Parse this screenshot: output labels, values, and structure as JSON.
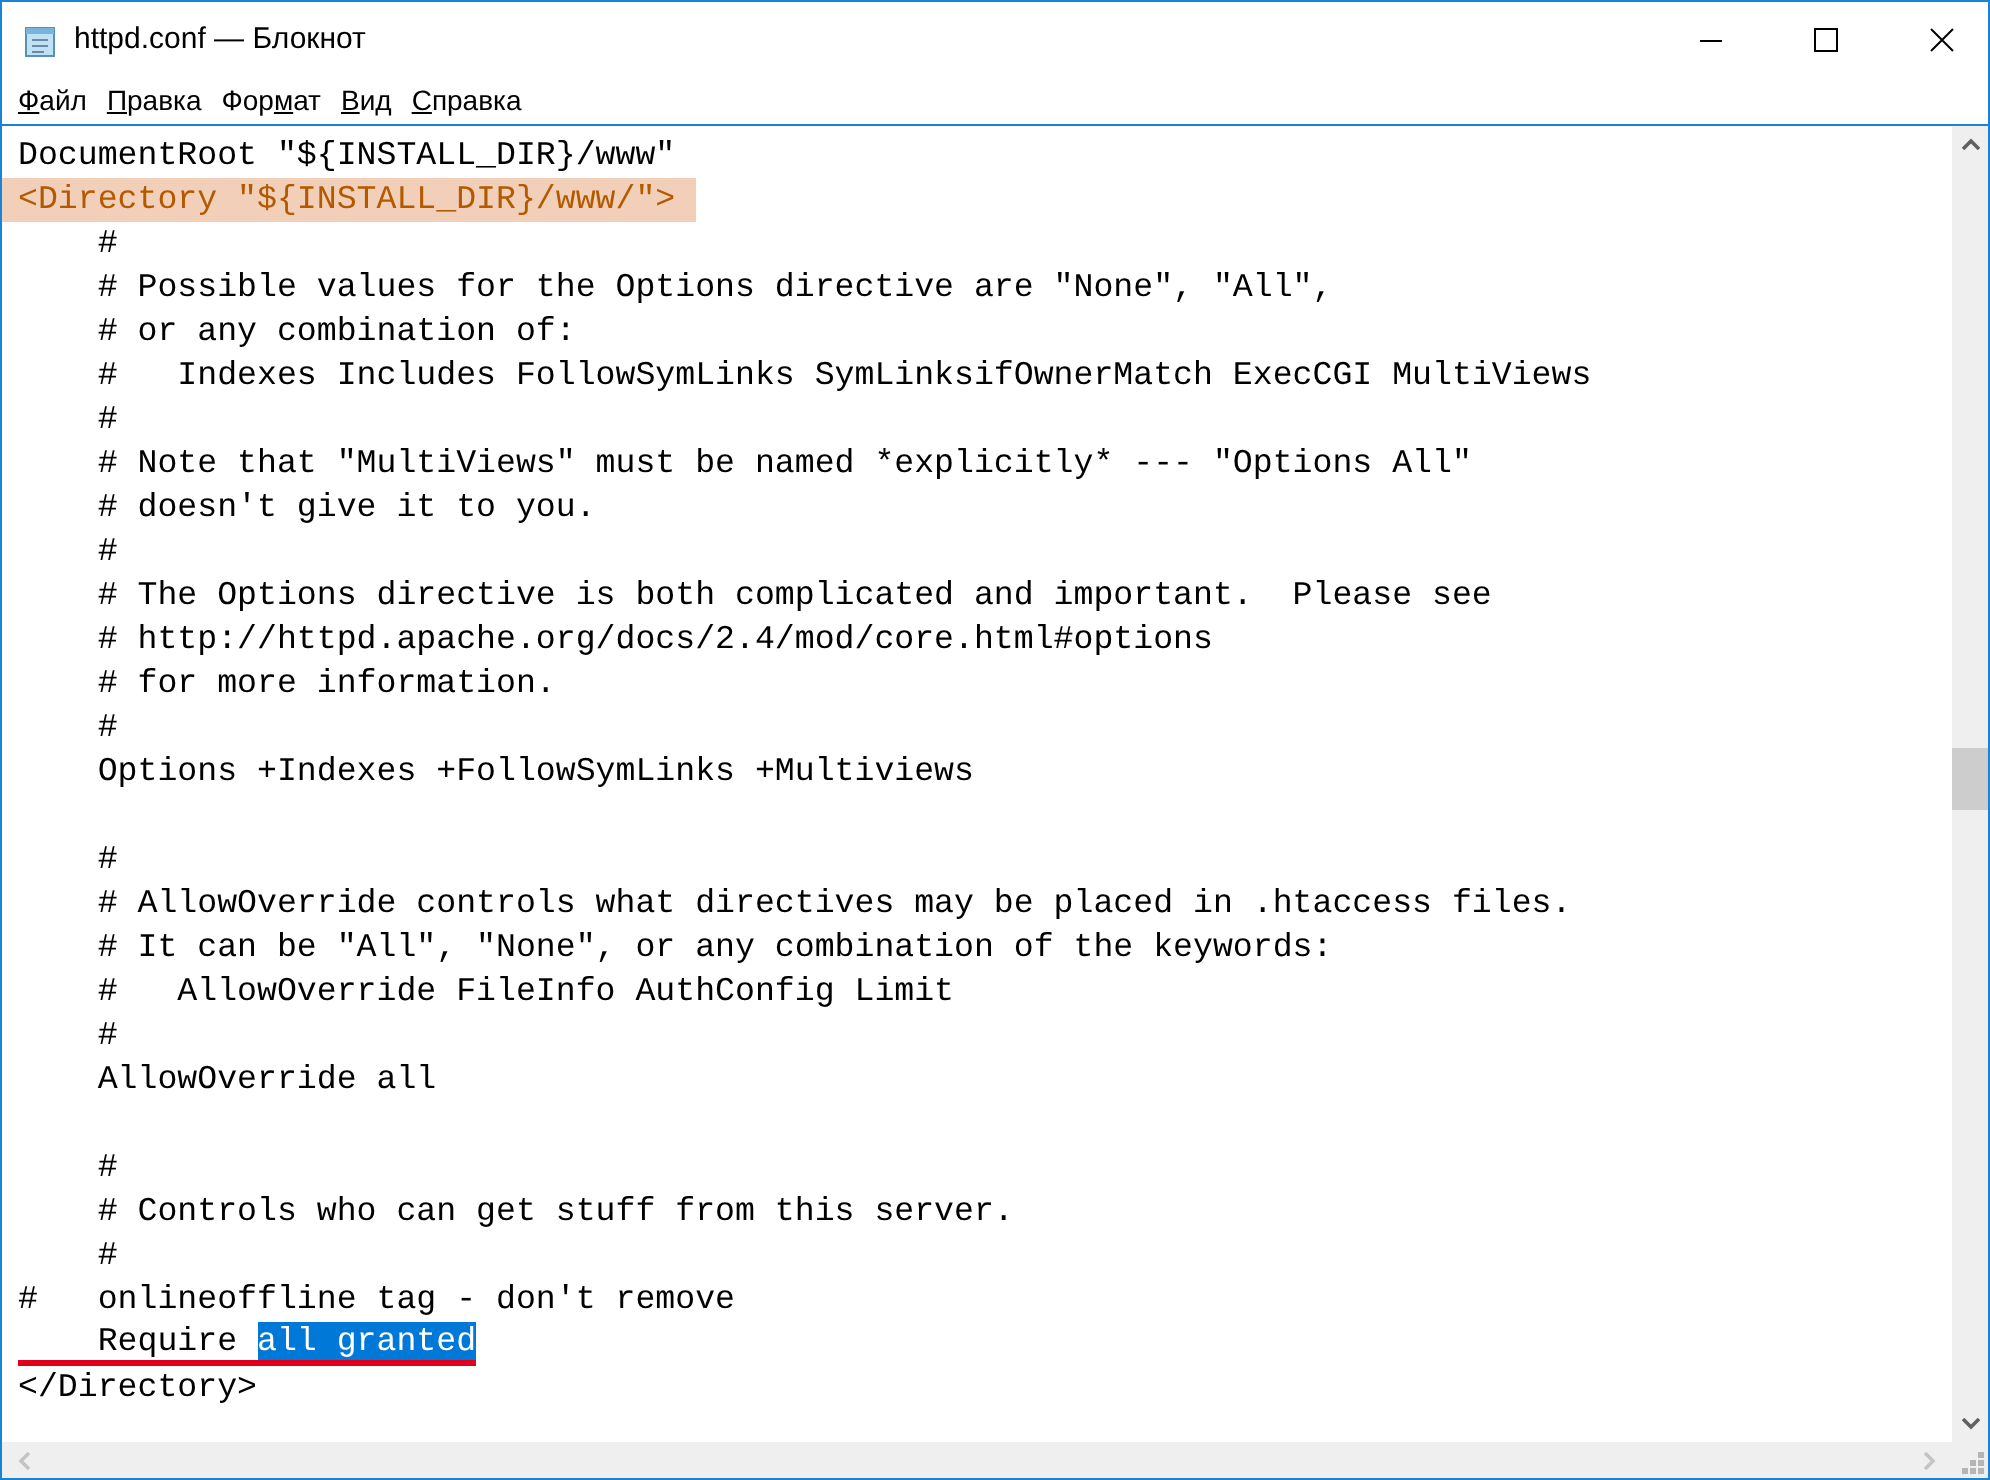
{
  "window": {
    "title": "httpd.conf — Блокнот"
  },
  "menu": [
    {
      "accel": "Ф",
      "rest": "айл"
    },
    {
      "accel": "П",
      "rest": "равка"
    },
    {
      "pre": "Фор",
      "accel": "м",
      "rest": "ат"
    },
    {
      "accel": "В",
      "rest": "ид"
    },
    {
      "accel": "С",
      "rest": "правка"
    }
  ],
  "lines": [
    {
      "kind": "code",
      "text": "DocumentRoot \"${INSTALL_DIR}/www\"",
      "highlighted": false,
      "underlined": false
    },
    {
      "kind": "code",
      "text": "<Directory \"${INSTALL_DIR}/www/\">",
      "highlighted": true,
      "underlined": false
    },
    {
      "kind": "code",
      "text": "    #",
      "highlighted": false,
      "underlined": false
    },
    {
      "kind": "code",
      "text": "    # Possible values for the Options directive are \"None\", \"All\",",
      "highlighted": false,
      "underlined": false
    },
    {
      "kind": "code",
      "text": "    # or any combination of:",
      "highlighted": false,
      "underlined": false
    },
    {
      "kind": "code",
      "text": "    #   Indexes Includes FollowSymLinks SymLinksifOwnerMatch ExecCGI MultiViews",
      "highlighted": false,
      "underlined": false
    },
    {
      "kind": "code",
      "text": "    #",
      "highlighted": false,
      "underlined": false
    },
    {
      "kind": "code",
      "text": "    # Note that \"MultiViews\" must be named *explicitly* --- \"Options All\"",
      "highlighted": false,
      "underlined": false
    },
    {
      "kind": "code",
      "text": "    # doesn't give it to you.",
      "highlighted": false,
      "underlined": false
    },
    {
      "kind": "code",
      "text": "    #",
      "highlighted": false,
      "underlined": false
    },
    {
      "kind": "code",
      "text": "    # The Options directive is both complicated and important.  Please see",
      "highlighted": false,
      "underlined": false
    },
    {
      "kind": "code",
      "text": "    # http://httpd.apache.org/docs/2.4/mod/core.html#options",
      "highlighted": false,
      "underlined": false
    },
    {
      "kind": "code",
      "text": "    # for more information.",
      "highlighted": false,
      "underlined": false
    },
    {
      "kind": "code",
      "text": "    #",
      "highlighted": false,
      "underlined": false
    },
    {
      "kind": "code",
      "text": "    Options +Indexes +FollowSymLinks +Multiviews",
      "highlighted": false,
      "underlined": false
    },
    {
      "kind": "blank"
    },
    {
      "kind": "code",
      "text": "    #",
      "highlighted": false,
      "underlined": false
    },
    {
      "kind": "code",
      "text": "    # AllowOverride controls what directives may be placed in .htaccess files.",
      "highlighted": false,
      "underlined": false
    },
    {
      "kind": "code",
      "text": "    # It can be \"All\", \"None\", or any combination of the keywords:",
      "highlighted": false,
      "underlined": false
    },
    {
      "kind": "code",
      "text": "    #   AllowOverride FileInfo AuthConfig Limit",
      "highlighted": false,
      "underlined": false
    },
    {
      "kind": "code",
      "text": "    #",
      "highlighted": false,
      "underlined": false
    },
    {
      "kind": "code",
      "text": "    AllowOverride all",
      "highlighted": false,
      "underlined": false
    },
    {
      "kind": "blank"
    },
    {
      "kind": "code",
      "text": "    #",
      "highlighted": false,
      "underlined": false
    },
    {
      "kind": "code",
      "text": "    # Controls who can get stuff from this server.",
      "highlighted": false,
      "underlined": false
    },
    {
      "kind": "code",
      "text": "    #",
      "highlighted": false,
      "underlined": false
    },
    {
      "kind": "code",
      "text": "#   onlineoffline tag - don't remove",
      "highlighted": false,
      "underlined": false
    },
    {
      "kind": "code",
      "text": "    Require ",
      "selected_text": "all granted",
      "highlighted": false,
      "underlined": true
    },
    {
      "kind": "code",
      "text": "</Directory>",
      "highlighted": false,
      "underlined": false
    }
  ]
}
